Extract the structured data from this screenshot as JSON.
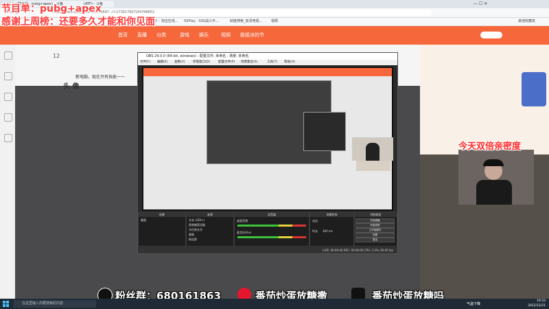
{
  "browser": {
    "tabs": [
      "(节目单：pubg+apex) - 斗鱼",
      "(ATF) - 斗鱼",
      "SSPlay - SSS战斗平...",
      "斜度搜索_高清电视..."
    ],
    "address": "https://www.douyu.com/9973687 -/-f-1739176072f4788852",
    "bookmarks": [
      "人 · 淘宝在线...",
      "SSPlay · SSS战斗平...",
      "斜度搜索_高清电视...",
      "视频"
    ],
    "right_bookmark": "其他收藏夹"
  },
  "site": {
    "nav": [
      "首页",
      "直播",
      "分类",
      "游戏",
      "娱乐",
      "视频",
      "极纸冰的节"
    ],
    "info_title": "新电脑，现在只有技能一一",
    "headline": "头 像",
    "room_num": "12"
  },
  "overlay": {
    "program": "节目单：pubg+apex",
    "thanks": "感谢上周榜：还要多久才能和你见面",
    "double": "今天双倍亲密度"
  },
  "obs": {
    "title": "OBS 29.0.0 (64-bit, windows) - 配置文件: 未命名 - 场景: 未命名",
    "menu": [
      "文件(F)",
      "编辑(E)",
      "查看(V)",
      "停靠窗口(D)",
      "配置文件(P)",
      "场景集合(S)",
      "工具(T)",
      "帮助(H)"
    ],
    "docks": [
      "场景",
      "来源",
      "混音器",
      "场景转场",
      "控制按钮"
    ],
    "scene": "截图",
    "sources": [
      "文本 (GDI+)",
      "视频捕获设备",
      "节目单文字",
      "图像",
      "粉丝群"
    ],
    "mixer": [
      "桌面音频",
      "麦克风/Aux"
    ],
    "controls": [
      "开始直播",
      "开始录制",
      "工作室模式",
      "设置",
      "退出"
    ],
    "transition": "淡出",
    "duration_label": "时长",
    "duration": "300 ms",
    "status": "LIVE: 00:00:00   REC: 00:00:00   CPU: 2.3%, 60.00 fps"
  },
  "social": {
    "fans_label": "粉丝群：680161863",
    "weibo_label": "番茄炒蛋放糖撒",
    "douyin_label": "番茄炒蛋放糖吗"
  },
  "taskbar": {
    "search_placeholder": "在这里输入你要搜索的内容",
    "time": "19:33",
    "date": "2022/12/21",
    "weather": "气温下降"
  }
}
